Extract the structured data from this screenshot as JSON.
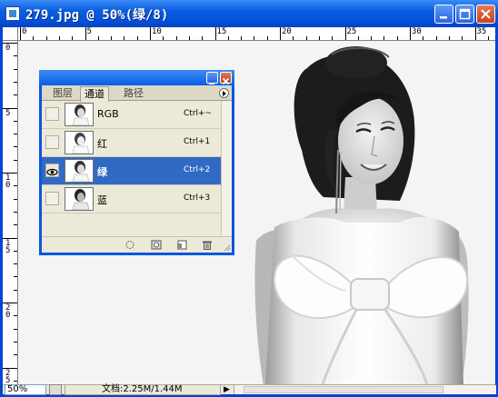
{
  "window": {
    "title": "279.jpg @ 50%(绿/8)",
    "accent": "#0a5de2"
  },
  "ruler": {
    "top_numbers": [
      "0",
      "5",
      "10",
      "15",
      "20",
      "25",
      "30",
      "35"
    ],
    "left_numbers": [
      "0",
      "5",
      "10",
      "15",
      "20",
      "25"
    ]
  },
  "channels_panel": {
    "tabs": [
      {
        "label": "图层"
      },
      {
        "label": "通道"
      },
      {
        "label": "路径"
      }
    ],
    "active_tab": "通道",
    "channels": [
      {
        "name": "RGB",
        "shortcut": "Ctrl+~"
      },
      {
        "name": "红",
        "shortcut": "Ctrl+1"
      },
      {
        "name": "绿",
        "shortcut": "Ctrl+2"
      },
      {
        "name": "蓝",
        "shortcut": "Ctrl+3"
      }
    ],
    "selected_channel": "绿",
    "selected_color": "#316ac5"
  },
  "statusbar": {
    "zoom": "50%",
    "doc_info": "文档:2.25M/1.44M"
  }
}
